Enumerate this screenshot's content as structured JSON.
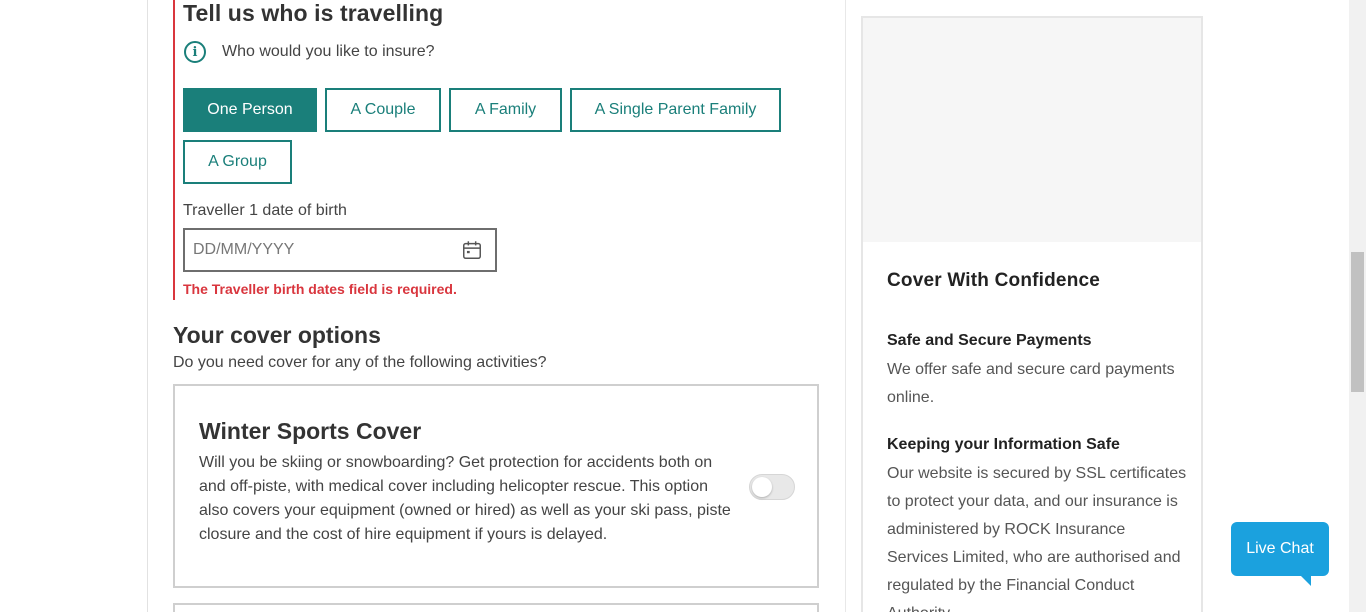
{
  "travellers": {
    "title": "Tell us who is travelling",
    "info_text": "Who would you like to insure?",
    "options": [
      "One Person",
      "A Couple",
      "A Family",
      "A Single Parent Family",
      "A Group"
    ],
    "selected": "One Person",
    "dob_label": "Traveller 1 date of birth",
    "dob_placeholder": "DD/MM/YYYY",
    "dob_value": "",
    "error": "The Traveller birth dates field is required."
  },
  "cover_options": {
    "title": "Your cover options",
    "subtitle": "Do you need cover for any of the following activities?",
    "winter_sports": {
      "title": "Winter Sports Cover",
      "description": "Will you be skiing or snowboarding? Get protection for accidents both on and off-piste, with medical cover including helicopter rescue. This option also covers your equipment (owned or hired) as well as your ski pass, piste closure and the cost of hire equipment if yours is delayed.",
      "enabled": false
    }
  },
  "sidebar": {
    "heading": "Cover With Confidence",
    "items": [
      {
        "title": "Safe and Secure Payments",
        "text": "We offer safe and secure card payments online."
      },
      {
        "title": "Keeping your Information Safe",
        "text": "Our website is secured by SSL certificates to protect your data, and our insurance is administered by ROCK Insurance Services Limited, who are authorised and regulated by the Financial Conduct Authority."
      }
    ]
  },
  "live_chat": {
    "label": "Live Chat"
  },
  "colors": {
    "primary": "#1a7f7a",
    "error": "#d9363e",
    "chat": "#1ba1de"
  },
  "icons": {
    "info": "info-icon",
    "calendar": "calendar-icon"
  }
}
